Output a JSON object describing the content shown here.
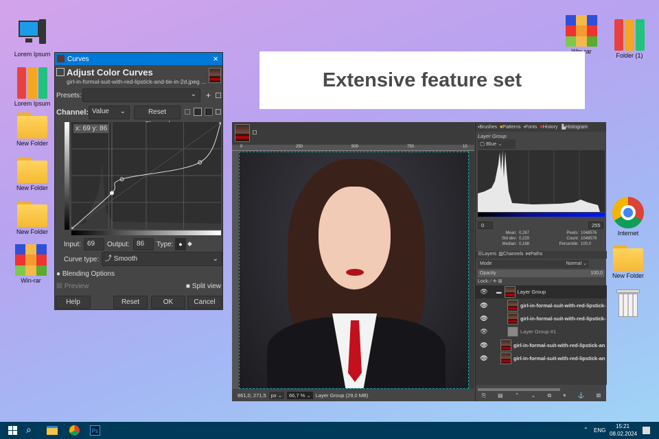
{
  "desktop": {
    "left_icons": [
      {
        "label": "Lorem Ipsum",
        "icon": "computer-icon"
      },
      {
        "label": "Lorem Ipsum",
        "icon": "binders-icon"
      },
      {
        "label": "New Folder",
        "icon": "folder-icon"
      },
      {
        "label": "New Folder",
        "icon": "folder-icon"
      },
      {
        "label": "New Folder",
        "icon": "folder-icon"
      },
      {
        "label": "Win-rar",
        "icon": "winrar-icon"
      }
    ],
    "right_icons": [
      {
        "label": "Win-rar",
        "icon": "winrar-icon"
      },
      {
        "label": "Folder (1)",
        "icon": "binders-icon"
      },
      {
        "label": "Internet",
        "icon": "chrome-icon"
      },
      {
        "label": "New Folder",
        "icon": "folder-icon"
      },
      {
        "label": "",
        "icon": "trash-icon"
      }
    ]
  },
  "banner": {
    "text": "Extensive feature set"
  },
  "curves": {
    "window_title": "Curves",
    "heading": "Adjust Color Curves",
    "filename": "girl-in-formal-suit-with-red-lipstick-and-tie-in-2d.jpeg ...",
    "presets_label": "Presets:",
    "presets_value": "",
    "channel_label": "Channel:",
    "channel_value": "Value",
    "reset_channel": "Reset Channel",
    "coord_readout": "x: 69 y: 86",
    "input_label": "Input:",
    "input_value": "69",
    "output_label": "Output:",
    "output_value": "86",
    "type_label": "Type:",
    "curve_type_label": "Curve type:",
    "curve_type_value": "Smooth",
    "blending": "Blending Options",
    "preview": "Preview",
    "split_view": "Split view",
    "buttons": {
      "help": "Help",
      "reset": "Reset",
      "ok": "OK",
      "cancel": "Cancel"
    },
    "points": [
      [
        0,
        0
      ],
      [
        69,
        86
      ],
      [
        86,
        119
      ],
      [
        219,
        159
      ],
      [
        255,
        255
      ]
    ]
  },
  "gimp": {
    "ruler": [
      "0",
      "250",
      "500",
      "750",
      "10"
    ],
    "status": {
      "coords": "861,0, 271,5",
      "unit": "px",
      "zoom": "66,7 %",
      "info": "Layer Group (29,0 MB)"
    },
    "dock_tabs": [
      "Brushes",
      "Patterns",
      "Fonts",
      "History",
      "Histogram"
    ],
    "histogram": {
      "layer": "Layer Group",
      "channel": "Blue",
      "min": "0",
      "max": "255",
      "mean_label": "Mean:",
      "mean": "0,267",
      "std_label": "Std dev:",
      "std": "0,229",
      "median_label": "Median:",
      "median": "0,188",
      "pixels_label": "Pixels:",
      "pixels": "1048576",
      "count_label": "Count:",
      "count": "1048576",
      "percentile_label": "Percentile:",
      "percentile": "100,0"
    },
    "layer_tabs": [
      "Layers",
      "Channels",
      "Paths"
    ],
    "mode_label": "Mode",
    "mode_value": "Normal",
    "opacity_label": "Opacity",
    "opacity_value": "100,0",
    "lock_label": "Lock:",
    "layers": [
      "Layer Group",
      "girl-in-formal-suit-with-red-lipstick-",
      "girl-in-formal-suit-with-red-lipstick-",
      "Layer Group #1",
      "girl-in-formal-suit-with-red-lipstick-an",
      "girl-in-formal-suit-with-red-lipstick-an"
    ]
  },
  "taskbar": {
    "lang": "ENG",
    "time": "15:21",
    "date": "08.02.2024",
    "ps_label": "Ps"
  }
}
